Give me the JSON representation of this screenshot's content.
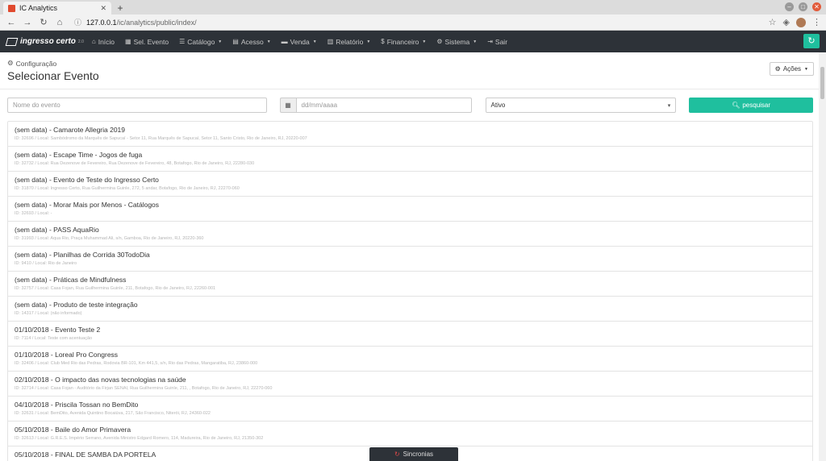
{
  "browser": {
    "tab_title": "IC Analytics",
    "url_host": "127.0.0.1",
    "url_path": "/ic/analytics/public/index/"
  },
  "nav": {
    "brand": "ingresso certo",
    "version": "2.0",
    "items": [
      {
        "icon": "home-icon",
        "glyph": "⌂",
        "label": "Início",
        "caret": false
      },
      {
        "icon": "calendar-icon",
        "glyph": "▦",
        "label": "Sel. Evento",
        "caret": false
      },
      {
        "icon": "list-icon",
        "glyph": "☰",
        "label": "Catálogo",
        "caret": true
      },
      {
        "icon": "card-icon",
        "glyph": "▤",
        "label": "Acesso",
        "caret": true
      },
      {
        "icon": "money-icon",
        "glyph": "▬",
        "label": "Venda",
        "caret": true
      },
      {
        "icon": "chart-icon",
        "glyph": "▥",
        "label": "Relatório",
        "caret": true
      },
      {
        "icon": "dollar-icon",
        "glyph": "$",
        "label": "Financeiro",
        "caret": true
      },
      {
        "icon": "gears-icon",
        "glyph": "⚙",
        "label": "Sistema",
        "caret": true
      },
      {
        "icon": "signout-icon",
        "glyph": "⇥",
        "label": "Sair",
        "caret": false
      }
    ]
  },
  "header": {
    "breadcrumb": "Configuração",
    "title": "Selecionar Evento",
    "actions_label": "Ações"
  },
  "filters": {
    "name_placeholder": "Nome do evento",
    "date_placeholder": "dd/mm/aaaa",
    "status_value": "Ativo",
    "search_label": "pesquisar"
  },
  "events": [
    {
      "title": "(sem data) - Camarote Allegria 2019",
      "sub": "ID: 32696 / Local: Sambódromo da Marquês de Sapucaí - Setor 11, Rua Marquês de Sapucaí, Setor 11, Santo Cristo, Rio de Janeiro, RJ, 20220-007"
    },
    {
      "title": "(sem data) - Escape Time - Jogos de fuga",
      "sub": "ID: 32732 / Local: Rua Dezenove de Fevereiro, Rua Dezenove de Fevereiro, 48, Botafogo, Rio de Janeiro, RJ, 22280-030"
    },
    {
      "title": "(sem data) - Evento de Teste do Ingresso Certo",
      "sub": "ID: 31870 / Local: Ingresso Certo, Rua Guilhermina Guinle, 272, 5 andar, Botafogo, Rio de Janeiro, RJ, 22270-060"
    },
    {
      "title": "(sem data) - Morar Mais por Menos - Catálogos",
      "sub": "ID: 32693 / Local: -"
    },
    {
      "title": "(sem data) - PASS AquaRio",
      "sub": "ID: 31993 / Local: Aqua Rio, Praça Muhammad Ali, s/n, Gamboa, Rio de Janeiro, RJ, 20220-360"
    },
    {
      "title": "(sem data) - Planilhas de Corrida 30TodoDia",
      "sub": "ID: 9410 / Local: Rio de Janeiro"
    },
    {
      "title": "(sem data) - Práticas de Mindfulness",
      "sub": "ID: 32757 / Local: Casa Fojan, Rua Guilhermina Guinle, 211, Botafogo, Rio de Janeiro, RJ, 22260-001"
    },
    {
      "title": "(sem data) - Produto de teste integração",
      "sub": "ID: 14317 / Local: (não informado)"
    },
    {
      "title": "01/10/2018 - Evento Teste 2",
      "sub": "ID: 7114 / Local: Teste com acentuação"
    },
    {
      "title": "01/10/2018 - Loreal Pro Congress",
      "sub": "ID: 32406 / Local: Club Med Rio das Pedras, Rodovia BR-101, Km 441,5, s/n, Rio das Pedras, Mangaratiba, RJ, 23860-000"
    },
    {
      "title": "02/10/2018 - O impacto das novas tecnologias na saúde",
      "sub": "ID: 32714 / Local: Casa Fojan - Auditório da Firjan SENAI, Rua Guilhermina Guinle, 211, , Botafogo, Rio de Janeiro, RJ, 22270-060"
    },
    {
      "title": "04/10/2018 - Priscila Tossan no BemDito",
      "sub": "ID: 32631 / Local: BemDito, Avenida Quintino Bocaiúva, 217, São Francisco, Niterói, RJ, 24360-022"
    },
    {
      "title": "05/10/2018 - Baile do Amor Primavera",
      "sub": "ID: 32613 / Local: G.R.E.S. Império Serrano, Avenida Ministro Edgard Romero, 114, Madureira, Rio de Janeiro, RJ, 21350-302"
    },
    {
      "title": "05/10/2018 - FINAL DE SAMBA DA PORTELA",
      "sub": ""
    }
  ],
  "sync_label": "Sincronias"
}
